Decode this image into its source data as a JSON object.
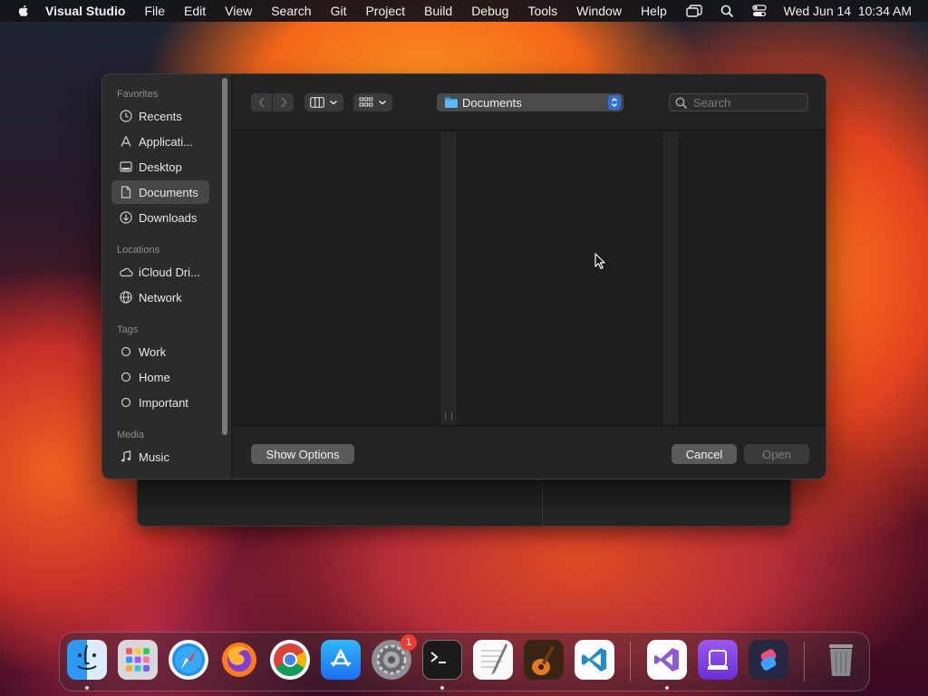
{
  "menubar": {
    "app_name": "Visual Studio",
    "items": [
      "File",
      "Edit",
      "View",
      "Search",
      "Git",
      "Project",
      "Build",
      "Debug",
      "Tools",
      "Window",
      "Help"
    ],
    "datetime": "Wed Jun 14  10:34 AM",
    "status_icons": [
      "stage-manager-icon",
      "spotlight-search-icon",
      "control-center-icon"
    ]
  },
  "sidebar": {
    "sections": [
      {
        "header": "Favorites",
        "items": [
          {
            "label": "Recents",
            "icon": "clock-icon"
          },
          {
            "label": "Applicati...",
            "icon": "applications-icon"
          },
          {
            "label": "Desktop",
            "icon": "desktop-icon"
          },
          {
            "label": "Documents",
            "icon": "document-icon",
            "selected": true
          },
          {
            "label": "Downloads",
            "icon": "download-icon"
          }
        ]
      },
      {
        "header": "Locations",
        "items": [
          {
            "label": "iCloud Dri...",
            "icon": "cloud-icon"
          },
          {
            "label": "Network",
            "icon": "globe-icon"
          }
        ]
      },
      {
        "header": "Tags",
        "items": [
          {
            "label": "Work",
            "icon": "tag-circle-icon"
          },
          {
            "label": "Home",
            "icon": "tag-circle-icon"
          },
          {
            "label": "Important",
            "icon": "tag-circle-icon"
          }
        ]
      },
      {
        "header": "Media",
        "items": [
          {
            "label": "Music",
            "icon": "music-note-icon"
          }
        ]
      }
    ]
  },
  "toolbar": {
    "location": "Documents",
    "search_placeholder": "Search"
  },
  "buttons": {
    "show_options": "Show Options",
    "cancel": "Cancel",
    "open": "Open"
  },
  "dock": {
    "apps": [
      {
        "name": "Finder",
        "running": true
      },
      {
        "name": "Launchpad"
      },
      {
        "name": "Safari"
      },
      {
        "name": "Firefox"
      },
      {
        "name": "Chrome"
      },
      {
        "name": "App Store"
      },
      {
        "name": "System Settings",
        "badge": "1"
      },
      {
        "name": "Terminal",
        "running": true
      },
      {
        "name": "TextEdit"
      },
      {
        "name": "GarageBand"
      },
      {
        "name": "Visual Studio Code"
      },
      {
        "name": "Visual Studio",
        "running": true
      },
      {
        "name": "Disk Utility"
      },
      {
        "name": "Shortcuts"
      },
      {
        "name": "Trash"
      }
    ]
  },
  "colors": {
    "accent": "#2f6fe0",
    "badge": "#ee3b30"
  }
}
